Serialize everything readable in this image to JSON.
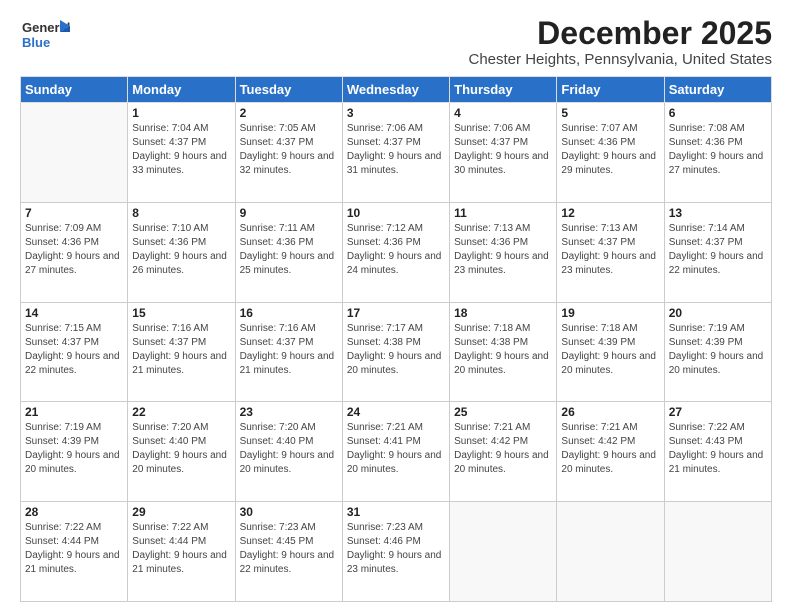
{
  "header": {
    "logo_general": "General",
    "logo_blue": "Blue",
    "month_title": "December 2025",
    "location": "Chester Heights, Pennsylvania, United States"
  },
  "columns": [
    "Sunday",
    "Monday",
    "Tuesday",
    "Wednesday",
    "Thursday",
    "Friday",
    "Saturday"
  ],
  "weeks": [
    [
      {
        "day": "",
        "sunrise": "",
        "sunset": "",
        "daylight": ""
      },
      {
        "day": "1",
        "sunrise": "Sunrise: 7:04 AM",
        "sunset": "Sunset: 4:37 PM",
        "daylight": "Daylight: 9 hours and 33 minutes."
      },
      {
        "day": "2",
        "sunrise": "Sunrise: 7:05 AM",
        "sunset": "Sunset: 4:37 PM",
        "daylight": "Daylight: 9 hours and 32 minutes."
      },
      {
        "day": "3",
        "sunrise": "Sunrise: 7:06 AM",
        "sunset": "Sunset: 4:37 PM",
        "daylight": "Daylight: 9 hours and 31 minutes."
      },
      {
        "day": "4",
        "sunrise": "Sunrise: 7:06 AM",
        "sunset": "Sunset: 4:37 PM",
        "daylight": "Daylight: 9 hours and 30 minutes."
      },
      {
        "day": "5",
        "sunrise": "Sunrise: 7:07 AM",
        "sunset": "Sunset: 4:36 PM",
        "daylight": "Daylight: 9 hours and 29 minutes."
      },
      {
        "day": "6",
        "sunrise": "Sunrise: 7:08 AM",
        "sunset": "Sunset: 4:36 PM",
        "daylight": "Daylight: 9 hours and 27 minutes."
      }
    ],
    [
      {
        "day": "7",
        "sunrise": "Sunrise: 7:09 AM",
        "sunset": "Sunset: 4:36 PM",
        "daylight": "Daylight: 9 hours and 27 minutes."
      },
      {
        "day": "8",
        "sunrise": "Sunrise: 7:10 AM",
        "sunset": "Sunset: 4:36 PM",
        "daylight": "Daylight: 9 hours and 26 minutes."
      },
      {
        "day": "9",
        "sunrise": "Sunrise: 7:11 AM",
        "sunset": "Sunset: 4:36 PM",
        "daylight": "Daylight: 9 hours and 25 minutes."
      },
      {
        "day": "10",
        "sunrise": "Sunrise: 7:12 AM",
        "sunset": "Sunset: 4:36 PM",
        "daylight": "Daylight: 9 hours and 24 minutes."
      },
      {
        "day": "11",
        "sunrise": "Sunrise: 7:13 AM",
        "sunset": "Sunset: 4:36 PM",
        "daylight": "Daylight: 9 hours and 23 minutes."
      },
      {
        "day": "12",
        "sunrise": "Sunrise: 7:13 AM",
        "sunset": "Sunset: 4:37 PM",
        "daylight": "Daylight: 9 hours and 23 minutes."
      },
      {
        "day": "13",
        "sunrise": "Sunrise: 7:14 AM",
        "sunset": "Sunset: 4:37 PM",
        "daylight": "Daylight: 9 hours and 22 minutes."
      }
    ],
    [
      {
        "day": "14",
        "sunrise": "Sunrise: 7:15 AM",
        "sunset": "Sunset: 4:37 PM",
        "daylight": "Daylight: 9 hours and 22 minutes."
      },
      {
        "day": "15",
        "sunrise": "Sunrise: 7:16 AM",
        "sunset": "Sunset: 4:37 PM",
        "daylight": "Daylight: 9 hours and 21 minutes."
      },
      {
        "day": "16",
        "sunrise": "Sunrise: 7:16 AM",
        "sunset": "Sunset: 4:37 PM",
        "daylight": "Daylight: 9 hours and 21 minutes."
      },
      {
        "day": "17",
        "sunrise": "Sunrise: 7:17 AM",
        "sunset": "Sunset: 4:38 PM",
        "daylight": "Daylight: 9 hours and 20 minutes."
      },
      {
        "day": "18",
        "sunrise": "Sunrise: 7:18 AM",
        "sunset": "Sunset: 4:38 PM",
        "daylight": "Daylight: 9 hours and 20 minutes."
      },
      {
        "day": "19",
        "sunrise": "Sunrise: 7:18 AM",
        "sunset": "Sunset: 4:39 PM",
        "daylight": "Daylight: 9 hours and 20 minutes."
      },
      {
        "day": "20",
        "sunrise": "Sunrise: 7:19 AM",
        "sunset": "Sunset: 4:39 PM",
        "daylight": "Daylight: 9 hours and 20 minutes."
      }
    ],
    [
      {
        "day": "21",
        "sunrise": "Sunrise: 7:19 AM",
        "sunset": "Sunset: 4:39 PM",
        "daylight": "Daylight: 9 hours and 20 minutes."
      },
      {
        "day": "22",
        "sunrise": "Sunrise: 7:20 AM",
        "sunset": "Sunset: 4:40 PM",
        "daylight": "Daylight: 9 hours and 20 minutes."
      },
      {
        "day": "23",
        "sunrise": "Sunrise: 7:20 AM",
        "sunset": "Sunset: 4:40 PM",
        "daylight": "Daylight: 9 hours and 20 minutes."
      },
      {
        "day": "24",
        "sunrise": "Sunrise: 7:21 AM",
        "sunset": "Sunset: 4:41 PM",
        "daylight": "Daylight: 9 hours and 20 minutes."
      },
      {
        "day": "25",
        "sunrise": "Sunrise: 7:21 AM",
        "sunset": "Sunset: 4:42 PM",
        "daylight": "Daylight: 9 hours and 20 minutes."
      },
      {
        "day": "26",
        "sunrise": "Sunrise: 7:21 AM",
        "sunset": "Sunset: 4:42 PM",
        "daylight": "Daylight: 9 hours and 20 minutes."
      },
      {
        "day": "27",
        "sunrise": "Sunrise: 7:22 AM",
        "sunset": "Sunset: 4:43 PM",
        "daylight": "Daylight: 9 hours and 21 minutes."
      }
    ],
    [
      {
        "day": "28",
        "sunrise": "Sunrise: 7:22 AM",
        "sunset": "Sunset: 4:44 PM",
        "daylight": "Daylight: 9 hours and 21 minutes."
      },
      {
        "day": "29",
        "sunrise": "Sunrise: 7:22 AM",
        "sunset": "Sunset: 4:44 PM",
        "daylight": "Daylight: 9 hours and 21 minutes."
      },
      {
        "day": "30",
        "sunrise": "Sunrise: 7:23 AM",
        "sunset": "Sunset: 4:45 PM",
        "daylight": "Daylight: 9 hours and 22 minutes."
      },
      {
        "day": "31",
        "sunrise": "Sunrise: 7:23 AM",
        "sunset": "Sunset: 4:46 PM",
        "daylight": "Daylight: 9 hours and 23 minutes."
      },
      {
        "day": "",
        "sunrise": "",
        "sunset": "",
        "daylight": ""
      },
      {
        "day": "",
        "sunrise": "",
        "sunset": "",
        "daylight": ""
      },
      {
        "day": "",
        "sunrise": "",
        "sunset": "",
        "daylight": ""
      }
    ]
  ]
}
